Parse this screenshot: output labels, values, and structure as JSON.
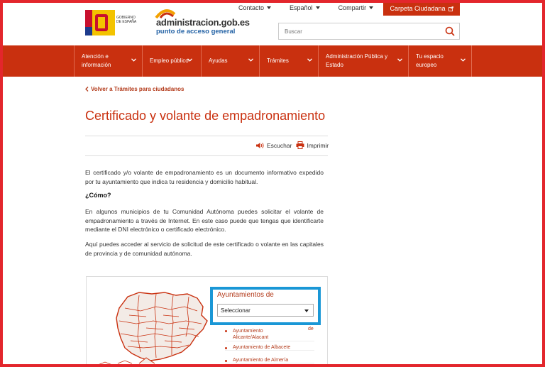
{
  "header": {
    "gov_logo_text": [
      "GOBIERNO",
      "DE ESPAÑA"
    ],
    "portal_title": "administracion.gob.es",
    "portal_subtitle": "punto de acceso general",
    "top_links": [
      "Contacto",
      "Español",
      "Compartir"
    ],
    "carpeta_label": "Carpeta Ciudadana",
    "search_placeholder": "Buscar"
  },
  "nav": {
    "items": [
      {
        "label": "Atención e información"
      },
      {
        "label": "Empleo público"
      },
      {
        "label": "Ayudas"
      },
      {
        "label": "Trámites"
      },
      {
        "label": "Administración Pública y Estado"
      },
      {
        "label": "Tu espacio europeo"
      }
    ]
  },
  "content": {
    "back_link": "Volver a Trámites para ciudadanos",
    "title": "Certificado y volante de empadronamiento",
    "listen_label": "Escuchar",
    "print_label": "Imprimir",
    "p1": "El certificado y/o volante de empadronamiento es un documento informativo expedido por tu ayuntamiento que indica tu residencia y domicilio habitual.",
    "heading_como": "¿Cómo?",
    "p2": "En algunos municipios de tu Comunidad Autónoma puedes solicitar el volante de empadronamiento a través de Internet. En este caso puede que tengas que identificarte mediante el DNI electrónico o certificado electrónico.",
    "p3": "Aquí puedes acceder al servicio de solicitud de este certificado o volante en las capitales de provincia y de comunidad autónoma."
  },
  "widget": {
    "title": "Ayuntamientos de",
    "select_value": "Seleccionar",
    "de_text": "de",
    "ayuntamientos": [
      "Ayuntamiento Alicante/Alacant",
      "Ayuntamiento de Albacete",
      "Ayuntamiento de Almería"
    ]
  },
  "colors": {
    "brand_red": "#c9300f",
    "frame_red": "#e3262c",
    "highlight_blue": "#1a97d6"
  }
}
